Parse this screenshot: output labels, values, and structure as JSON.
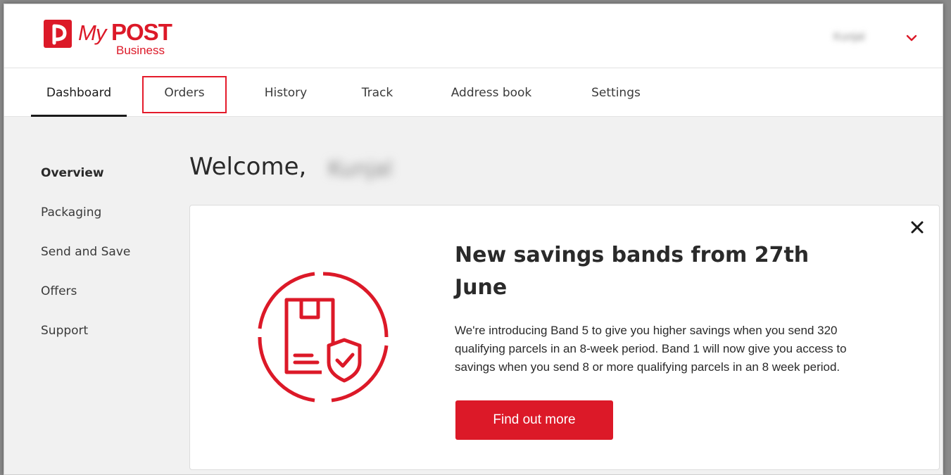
{
  "brand": {
    "name_my": "My",
    "name_post": "POST",
    "name_sub": "Business",
    "color": "#dc1928"
  },
  "header": {
    "user_name": "Kunjal",
    "user_menu_icon": "chevron-down-icon"
  },
  "nav": {
    "tabs": [
      {
        "label": "Dashboard",
        "active": true
      },
      {
        "label": "Orders",
        "active": false
      },
      {
        "label": "History",
        "active": false
      },
      {
        "label": "Track",
        "active": false
      },
      {
        "label": "Address book",
        "active": false
      },
      {
        "label": "Settings",
        "active": false
      }
    ],
    "highlight_color": "#e41b2b"
  },
  "sidebar": {
    "items": [
      {
        "label": "Overview",
        "active": true
      },
      {
        "label": "Packaging",
        "active": false
      },
      {
        "label": "Send and Save",
        "active": false
      },
      {
        "label": "Offers",
        "active": false
      },
      {
        "label": "Support",
        "active": false
      }
    ]
  },
  "main": {
    "welcome_prefix": "Welcome,",
    "welcome_name": "Kunjal"
  },
  "banner": {
    "title": "New savings bands from 27th June",
    "body": "We're introducing Band 5 to give you higher savings when you send 320 qualifying parcels in an 8-week period. Band 1 will now give you access to savings when you send 8 or more qualifying parcels in an 8 week period.",
    "cta_label": "Find out more",
    "icon": "parcel-shield-icon",
    "close_icon": "close-icon"
  }
}
